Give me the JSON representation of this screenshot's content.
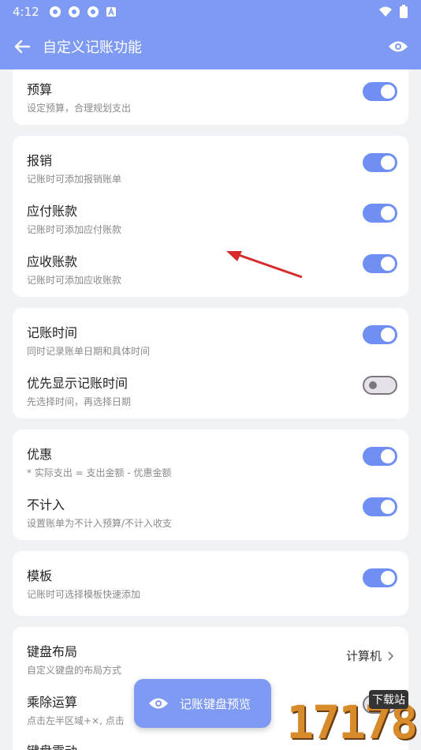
{
  "status": {
    "time": "4:12",
    "icons": [
      "app-badge-icon",
      "app-badge-icon",
      "app-badge-icon",
      "a-icon"
    ],
    "right_icons": [
      "wifi-icon",
      "battery-icon"
    ]
  },
  "app_bar": {
    "title": "自定义记账功能"
  },
  "sections": {
    "budget": {
      "title": "预算",
      "subtitle": "设定预算，合理规划支出",
      "on": true
    },
    "reimburse": {
      "title": "报销",
      "subtitle": "记账时可添加报销账单",
      "on": true
    },
    "payable": {
      "title": "应付账款",
      "subtitle": "记账时可添加应付账款",
      "on": true
    },
    "receivable": {
      "title": "应收账款",
      "subtitle": "记账时可添加应收账款",
      "on": true
    },
    "record_time": {
      "title": "记账时间",
      "subtitle": "同时记录账单日期和具体时间",
      "on": true
    },
    "show_time_first": {
      "title": "优先显示记账时间",
      "subtitle": "先选择时间，再选择日期",
      "on": false
    },
    "discount": {
      "title": "优惠",
      "subtitle": "* 实际支出 = 支出金额 - 优惠金额",
      "on": true
    },
    "exclude": {
      "title": "不计入",
      "subtitle": "设置账单为不计入预算/不计入收支",
      "on": true
    },
    "template": {
      "title": "模板",
      "subtitle": "记账时可选择模板快速添加",
      "on": true
    },
    "keyboard_layout": {
      "title": "键盘布局",
      "subtitle": "自定义键盘的布局方式",
      "value": "计算机"
    },
    "multiply": {
      "title": "乘除运算",
      "subtitle": "点击左半区域+×, 点击"
    },
    "vibration": {
      "title": "键盘震动"
    }
  },
  "fab": {
    "label": "记账键盘预览"
  },
  "watermark": {
    "digits": "17178",
    "badge": "下载站"
  },
  "colors": {
    "accent": "#7e9af3",
    "switch_on": "#6f90f2"
  }
}
